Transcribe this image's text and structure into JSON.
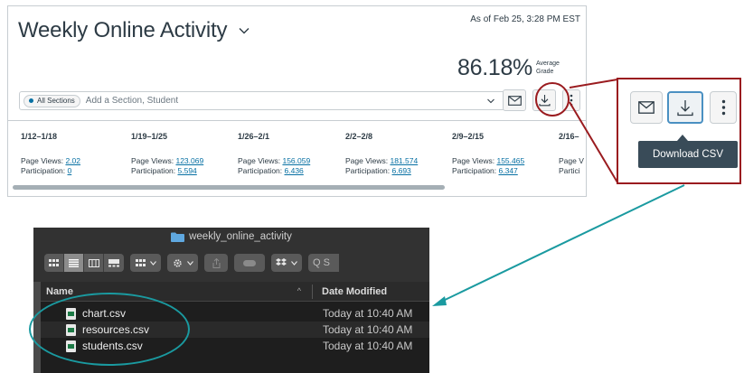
{
  "panel": {
    "title": "Weekly Online Activity",
    "as_of": "As of Feb 25, 3:28 PM EST",
    "average_grade_value": "86.18%",
    "average_grade_label_line1": "Average",
    "average_grade_label_line2": "Grade",
    "filter": {
      "pill_label": "All Sections",
      "placeholder": "Add a Section, Student"
    },
    "weeks": [
      {
        "range": "1/12–1/18",
        "page_views_label": "Page Views: ",
        "page_views": "2.02",
        "participation_label": "Participation: ",
        "participation": "0"
      },
      {
        "range": "1/19–1/25",
        "page_views_label": "Page Views: ",
        "page_views": "123.069",
        "participation_label": "Participation: ",
        "participation": "5.594"
      },
      {
        "range": "1/26–2/1",
        "page_views_label": "Page Views: ",
        "page_views": "156.059",
        "participation_label": "Participation: ",
        "participation": "6.436"
      },
      {
        "range": "2/2–2/8",
        "page_views_label": "Page Views: ",
        "page_views": "181.574",
        "participation_label": "Participation: ",
        "participation": "6.693"
      },
      {
        "range": "2/9–2/15",
        "page_views_label": "Page Views: ",
        "page_views": "155.465",
        "participation_label": "Participation: ",
        "participation": "6.347"
      },
      {
        "range": "2/16–",
        "page_views_label": "Page V",
        "page_views": "",
        "participation_label": "Partici",
        "participation": ""
      }
    ]
  },
  "zoom": {
    "tooltip": "Download CSV"
  },
  "finder": {
    "title": "weekly_online_activity",
    "search_placeholder": "Q S",
    "columns": {
      "name": "Name",
      "date": "Date Modified"
    },
    "files": [
      {
        "name": "chart.csv",
        "modified": "Today at 10:40 AM"
      },
      {
        "name": "resources.csv",
        "modified": "Today at 10:40 AM"
      },
      {
        "name": "students.csv",
        "modified": "Today at 10:40 AM"
      }
    ]
  },
  "colors": {
    "highlight_red": "#9a1b1f",
    "annotation_teal": "#1a9aa0",
    "link_blue": "#0770a3",
    "tooltip_bg": "#394b58"
  }
}
